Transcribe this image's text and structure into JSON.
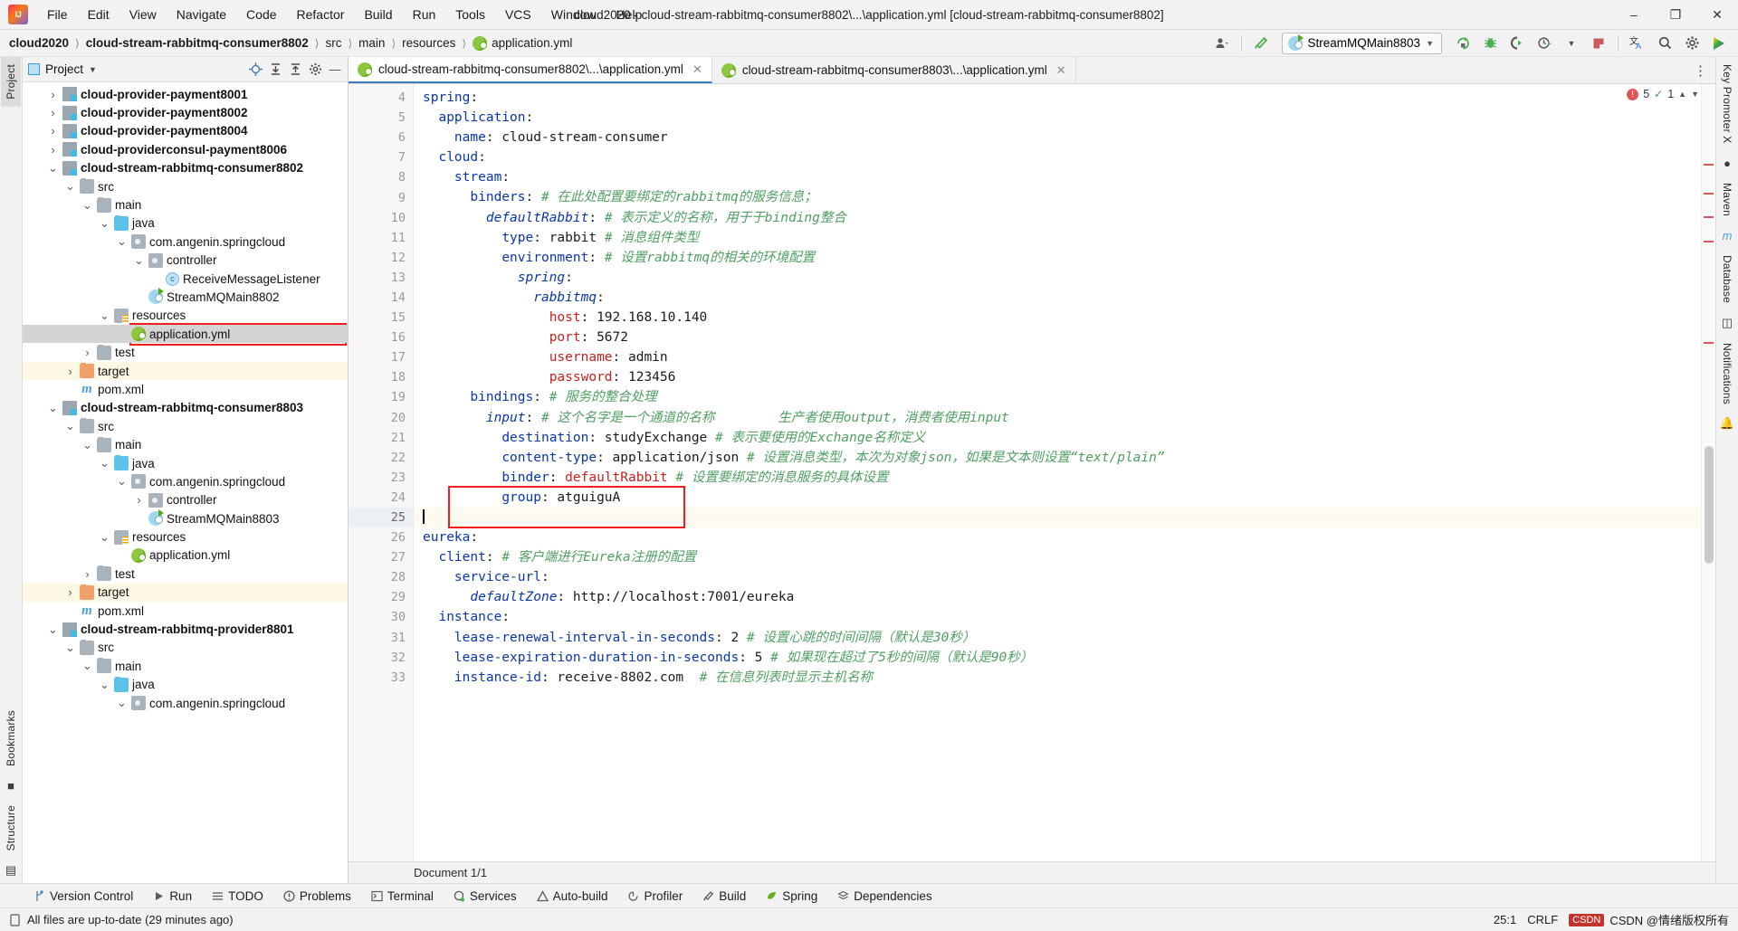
{
  "window": {
    "title": "cloud2020 - cloud-stream-rabbitmq-consumer8802\\...\\application.yml [cloud-stream-rabbitmq-consumer8802]",
    "minimize": "–",
    "maximize": "❐",
    "close": "✕"
  },
  "menu": [
    "File",
    "Edit",
    "View",
    "Navigate",
    "Code",
    "Refactor",
    "Build",
    "Run",
    "Tools",
    "VCS",
    "Window",
    "Help"
  ],
  "breadcrumb": [
    {
      "label": "cloud2020",
      "bold": true
    },
    {
      "label": "cloud-stream-rabbitmq-consumer8802",
      "bold": true
    },
    {
      "label": "src",
      "bold": false
    },
    {
      "label": "main",
      "bold": false
    },
    {
      "label": "resources",
      "bold": false
    },
    {
      "label": "application.yml",
      "bold": false,
      "icon": "spring-yml-icon"
    }
  ],
  "toolbar": {
    "run_config": "StreamMQMain8803",
    "icons": [
      "user-icon",
      "build-hammer-icon",
      "run-icon",
      "debug-icon",
      "coverage-icon",
      "profiler-icon",
      "dropdown-icon",
      "stop-icon",
      "translate-icon",
      "search-icon",
      "settings-icon",
      "ide-assistant-icon"
    ]
  },
  "project_pane": {
    "title": "Project",
    "actions": [
      "target-icon",
      "collapse-icon",
      "expand-icon",
      "settings-icon",
      "hide-icon"
    ],
    "tree": [
      {
        "label": "cloud-provider-payment8001",
        "indent": 1,
        "arrow": "›",
        "icon": "module-icon",
        "bold": true
      },
      {
        "label": "cloud-provider-payment8002",
        "indent": 1,
        "arrow": "›",
        "icon": "module-icon",
        "bold": true
      },
      {
        "label": "cloud-provider-payment8004",
        "indent": 1,
        "arrow": "›",
        "icon": "module-icon",
        "bold": true
      },
      {
        "label": "cloud-providerconsul-payment8006",
        "indent": 1,
        "arrow": "›",
        "icon": "module-icon",
        "bold": true
      },
      {
        "label": "cloud-stream-rabbitmq-consumer8802",
        "indent": 1,
        "arrow": "⌄",
        "icon": "module-icon",
        "bold": true
      },
      {
        "label": "src",
        "indent": 2,
        "arrow": "⌄",
        "icon": "folder-icon",
        "bold": false
      },
      {
        "label": "main",
        "indent": 3,
        "arrow": "⌄",
        "icon": "folder-icon",
        "bold": false
      },
      {
        "label": "java",
        "indent": 4,
        "arrow": "⌄",
        "icon": "folder-blue-icon",
        "bold": false
      },
      {
        "label": "com.angenin.springcloud",
        "indent": 5,
        "arrow": "⌄",
        "icon": "package-icon",
        "bold": false
      },
      {
        "label": "controller",
        "indent": 6,
        "arrow": "⌄",
        "icon": "package-icon",
        "bold": false
      },
      {
        "label": "ReceiveMessageListener",
        "indent": 7,
        "arrow": "",
        "icon": "class-icon",
        "bold": false
      },
      {
        "label": "StreamMQMain8802",
        "indent": 6,
        "arrow": "",
        "icon": "springboot-class-icon",
        "bold": false
      },
      {
        "label": "resources",
        "indent": 4,
        "arrow": "⌄",
        "icon": "resources-icon",
        "bold": false
      },
      {
        "label": "application.yml",
        "indent": 5,
        "arrow": "",
        "icon": "spring-yml-icon",
        "bold": false,
        "selected": true,
        "highlight": true
      },
      {
        "label": "test",
        "indent": 3,
        "arrow": "›",
        "icon": "folder-icon",
        "bold": false
      },
      {
        "label": "target",
        "indent": 2,
        "arrow": "›",
        "icon": "folder-orange-icon",
        "bold": false,
        "excluded": true
      },
      {
        "label": "pom.xml",
        "indent": 2,
        "arrow": "",
        "icon": "maven-icon",
        "bold": false
      },
      {
        "label": "cloud-stream-rabbitmq-consumer8803",
        "indent": 1,
        "arrow": "⌄",
        "icon": "module-icon",
        "bold": true
      },
      {
        "label": "src",
        "indent": 2,
        "arrow": "⌄",
        "icon": "folder-icon",
        "bold": false
      },
      {
        "label": "main",
        "indent": 3,
        "arrow": "⌄",
        "icon": "folder-icon",
        "bold": false
      },
      {
        "label": "java",
        "indent": 4,
        "arrow": "⌄",
        "icon": "folder-blue-icon",
        "bold": false
      },
      {
        "label": "com.angenin.springcloud",
        "indent": 5,
        "arrow": "⌄",
        "icon": "package-icon",
        "bold": false
      },
      {
        "label": "controller",
        "indent": 6,
        "arrow": "›",
        "icon": "package-icon",
        "bold": false
      },
      {
        "label": "StreamMQMain8803",
        "indent": 6,
        "arrow": "",
        "icon": "springboot-class-icon",
        "bold": false
      },
      {
        "label": "resources",
        "indent": 4,
        "arrow": "⌄",
        "icon": "resources-icon",
        "bold": false
      },
      {
        "label": "application.yml",
        "indent": 5,
        "arrow": "",
        "icon": "spring-yml-icon",
        "bold": false
      },
      {
        "label": "test",
        "indent": 3,
        "arrow": "›",
        "icon": "folder-icon",
        "bold": false
      },
      {
        "label": "target",
        "indent": 2,
        "arrow": "›",
        "icon": "folder-orange-icon",
        "bold": false,
        "excluded": true
      },
      {
        "label": "pom.xml",
        "indent": 2,
        "arrow": "",
        "icon": "maven-icon",
        "bold": false
      },
      {
        "label": "cloud-stream-rabbitmq-provider8801",
        "indent": 1,
        "arrow": "⌄",
        "icon": "module-icon",
        "bold": true
      },
      {
        "label": "src",
        "indent": 2,
        "arrow": "⌄",
        "icon": "folder-icon",
        "bold": false
      },
      {
        "label": "main",
        "indent": 3,
        "arrow": "⌄",
        "icon": "folder-icon",
        "bold": false
      },
      {
        "label": "java",
        "indent": 4,
        "arrow": "⌄",
        "icon": "folder-blue-icon",
        "bold": false
      },
      {
        "label": "com.angenin.springcloud",
        "indent": 5,
        "arrow": "⌄",
        "icon": "package-icon",
        "bold": false
      }
    ]
  },
  "left_strip": [
    "Project",
    "Bookmarks",
    "Structure"
  ],
  "right_strip": [
    "Key Promoter X",
    "Maven",
    "Database",
    "Notifications"
  ],
  "editor": {
    "tabs": [
      {
        "label": "cloud-stream-rabbitmq-consumer8802\\...\\application.yml",
        "active": true,
        "icon": "spring-yml-icon"
      },
      {
        "label": "cloud-stream-rabbitmq-consumer8803\\...\\application.yml",
        "active": false,
        "icon": "spring-yml-icon"
      }
    ],
    "inspections": {
      "errors": "5",
      "warnings": "1"
    },
    "document_status": "Document 1/1",
    "first_line_number": 4,
    "current_line": 25,
    "highlight_box_lines": [
      24,
      25
    ],
    "lines": [
      {
        "n": 4,
        "fold": "−",
        "segments": [
          {
            "t": "spring",
            "c": "key"
          },
          {
            "t": ":",
            "c": "val"
          }
        ],
        "indent": 0
      },
      {
        "n": 5,
        "fold": "−",
        "segments": [
          {
            "t": "application",
            "c": "key"
          },
          {
            "t": ":",
            "c": "val"
          }
        ],
        "indent": 2
      },
      {
        "n": 6,
        "fold": "−",
        "segments": [
          {
            "t": "name",
            "c": "key"
          },
          {
            "t": ": cloud-stream-consumer",
            "c": "val"
          }
        ],
        "indent": 4
      },
      {
        "n": 7,
        "fold": "−",
        "segments": [
          {
            "t": "cloud",
            "c": "key"
          },
          {
            "t": ":",
            "c": "val"
          }
        ],
        "indent": 2
      },
      {
        "n": 8,
        "fold": "−",
        "segments": [
          {
            "t": "stream",
            "c": "key"
          },
          {
            "t": ":",
            "c": "val"
          }
        ],
        "indent": 4
      },
      {
        "n": 9,
        "fold": "−",
        "segments": [
          {
            "t": "binders",
            "c": "key"
          },
          {
            "t": ": ",
            "c": "val"
          },
          {
            "t": "# 在此处配置要绑定的rabbitmq的服务信息；",
            "c": "cm"
          }
        ],
        "indent": 6
      },
      {
        "n": 10,
        "fold": "−",
        "segments": [
          {
            "t": "defaultRabbit",
            "c": "it"
          },
          {
            "t": ": ",
            "c": "val"
          },
          {
            "t": "# 表示定义的名称，用于于binding整合",
            "c": "cm"
          }
        ],
        "indent": 8
      },
      {
        "n": 11,
        "fold": "",
        "segments": [
          {
            "t": "type",
            "c": "key"
          },
          {
            "t": ": rabbit ",
            "c": "val"
          },
          {
            "t": "# 消息组件类型",
            "c": "cm"
          }
        ],
        "indent": 10
      },
      {
        "n": 12,
        "fold": "−",
        "segments": [
          {
            "t": "environment",
            "c": "key"
          },
          {
            "t": ": ",
            "c": "val"
          },
          {
            "t": "# 设置rabbitmq的相关的环境配置",
            "c": "cm"
          }
        ],
        "indent": 10
      },
      {
        "n": 13,
        "fold": "−",
        "segments": [
          {
            "t": "spring",
            "c": "it"
          },
          {
            "t": ":",
            "c": "val"
          }
        ],
        "indent": 12
      },
      {
        "n": 14,
        "fold": "−",
        "segments": [
          {
            "t": "rabbitmq",
            "c": "it"
          },
          {
            "t": ":",
            "c": "val"
          }
        ],
        "indent": 14
      },
      {
        "n": 15,
        "fold": "",
        "segments": [
          {
            "t": "host",
            "c": "keyr"
          },
          {
            "t": ": 192.168.10.140",
            "c": "val"
          }
        ],
        "indent": 16
      },
      {
        "n": 16,
        "fold": "",
        "segments": [
          {
            "t": "port",
            "c": "keyr"
          },
          {
            "t": ": 5672",
            "c": "val"
          }
        ],
        "indent": 16
      },
      {
        "n": 17,
        "fold": "",
        "segments": [
          {
            "t": "username",
            "c": "keyr"
          },
          {
            "t": ": admin",
            "c": "val"
          }
        ],
        "indent": 16
      },
      {
        "n": 18,
        "fold": "−",
        "segments": [
          {
            "t": "password",
            "c": "keyr"
          },
          {
            "t": ": 123456",
            "c": "val"
          }
        ],
        "indent": 16
      },
      {
        "n": 19,
        "fold": "−",
        "segments": [
          {
            "t": "bindings",
            "c": "key"
          },
          {
            "t": ": ",
            "c": "val"
          },
          {
            "t": "# 服务的整合处理",
            "c": "cm"
          }
        ],
        "indent": 6
      },
      {
        "n": 20,
        "fold": "−",
        "segments": [
          {
            "t": "input",
            "c": "it"
          },
          {
            "t": ": ",
            "c": "val"
          },
          {
            "t": "# 这个名字是一个通道的名称        生产者使用output，消费者使用input",
            "c": "cm"
          }
        ],
        "indent": 8
      },
      {
        "n": 21,
        "fold": "",
        "segments": [
          {
            "t": "destination",
            "c": "key"
          },
          {
            "t": ": studyExchange ",
            "c": "val"
          },
          {
            "t": "# 表示要使用的Exchange名称定义",
            "c": "cm"
          }
        ],
        "indent": 10
      },
      {
        "n": 22,
        "fold": "",
        "segments": [
          {
            "t": "content-type",
            "c": "key"
          },
          {
            "t": ": application/json ",
            "c": "val"
          },
          {
            "t": "# 设置消息类型，本次为对象json，如果是文本则设置“text/plain”",
            "c": "cm"
          }
        ],
        "indent": 10
      },
      {
        "n": 23,
        "fold": "",
        "segments": [
          {
            "t": "binder",
            "c": "key"
          },
          {
            "t": ": ",
            "c": "val"
          },
          {
            "t": "defaultRabbit",
            "c": "keyr"
          },
          {
            "t": " ",
            "c": "val"
          },
          {
            "t": "# 设置要绑定的消息服务的具体设置",
            "c": "cm"
          }
        ],
        "indent": 10
      },
      {
        "n": 24,
        "fold": "−",
        "segments": [
          {
            "t": "group",
            "c": "key"
          },
          {
            "t": ": atguiguA",
            "c": "val"
          }
        ],
        "indent": 10
      },
      {
        "n": 25,
        "fold": "",
        "segments": [],
        "indent": 0,
        "caret": true
      },
      {
        "n": 26,
        "fold": "−",
        "segments": [
          {
            "t": "eureka",
            "c": "key"
          },
          {
            "t": ":",
            "c": "val"
          }
        ],
        "indent": 0
      },
      {
        "n": 27,
        "fold": "−",
        "segments": [
          {
            "t": "client",
            "c": "key"
          },
          {
            "t": ": ",
            "c": "val"
          },
          {
            "t": "# 客户端进行Eureka注册的配置",
            "c": "cm"
          }
        ],
        "indent": 2
      },
      {
        "n": 28,
        "fold": "−",
        "segments": [
          {
            "t": "service-url",
            "c": "key"
          },
          {
            "t": ":",
            "c": "val"
          }
        ],
        "indent": 4
      },
      {
        "n": 29,
        "fold": "−",
        "segments": [
          {
            "t": "defaultZone",
            "c": "it"
          },
          {
            "t": ": http://localhost:7001/eureka",
            "c": "val"
          }
        ],
        "indent": 6
      },
      {
        "n": 30,
        "fold": "−",
        "segments": [
          {
            "t": "instance",
            "c": "key"
          },
          {
            "t": ":",
            "c": "val"
          }
        ],
        "indent": 2
      },
      {
        "n": 31,
        "fold": "",
        "segments": [
          {
            "t": "lease-renewal-interval-in-seconds",
            "c": "key"
          },
          {
            "t": ": 2 ",
            "c": "val"
          },
          {
            "t": "# 设置心跳的时间间隔（默认是30秒）",
            "c": "cm"
          }
        ],
        "indent": 4
      },
      {
        "n": 32,
        "fold": "",
        "segments": [
          {
            "t": "lease-expiration-duration-in-seconds",
            "c": "key"
          },
          {
            "t": ": 5 ",
            "c": "val"
          },
          {
            "t": "# 如果现在超过了5秒的间隔（默认是90秒）",
            "c": "cm"
          }
        ],
        "indent": 4
      },
      {
        "n": 33,
        "fold": "",
        "segments": [
          {
            "t": "instance-id",
            "c": "key"
          },
          {
            "t": ": receive-8802.com  ",
            "c": "val"
          },
          {
            "t": "# 在信息列表时显示主机名称",
            "c": "cm"
          }
        ],
        "indent": 4
      }
    ]
  },
  "bottom_tools": [
    {
      "label": "Version Control",
      "icon": "branch-icon"
    },
    {
      "label": "Run",
      "icon": "run-icon"
    },
    {
      "label": "TODO",
      "icon": "todo-icon"
    },
    {
      "label": "Problems",
      "icon": "problems-icon"
    },
    {
      "label": "Terminal",
      "icon": "terminal-icon"
    },
    {
      "label": "Services",
      "icon": "services-icon"
    },
    {
      "label": "Auto-build",
      "icon": "autobuild-icon"
    },
    {
      "label": "Profiler",
      "icon": "profiler-icon"
    },
    {
      "label": "Build",
      "icon": "build-hammer-icon"
    },
    {
      "label": "Spring",
      "icon": "spring-icon"
    },
    {
      "label": "Dependencies",
      "icon": "dependencies-icon"
    }
  ],
  "statusbar": {
    "message": "All files are up-to-date (29 minutes ago)",
    "caret_position": "25:1",
    "line_separator": "CRLF",
    "watermark": "CSDN @情绪版权所有"
  }
}
